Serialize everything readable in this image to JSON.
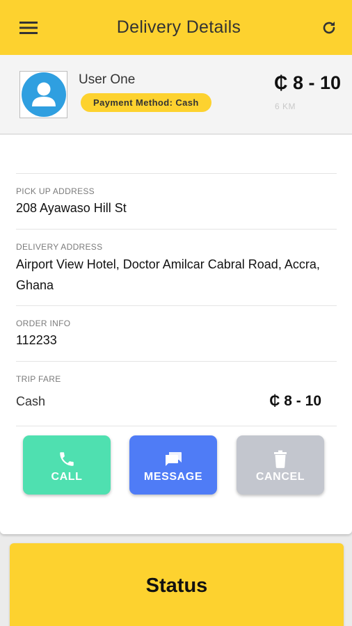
{
  "header": {
    "title": "Delivery Details",
    "menu_icon": "hamburger-menu-icon",
    "refresh_icon": "refresh-icon"
  },
  "user": {
    "name": "User One",
    "payment_badge": "Payment Method: Cash",
    "price": "₵ 8 - 10",
    "distance": "6 KM",
    "avatar_icon": "user-avatar-icon"
  },
  "details": {
    "pickup_label": "PICK UP ADDRESS",
    "pickup_value": "208 Ayawaso Hill St",
    "delivery_label": "DELIVERY ADDRESS",
    "delivery_value": "Airport View Hotel, Doctor Amilcar Cabral Road, Accra, Ghana",
    "order_label": "ORDER INFO",
    "order_value": "112233",
    "fare_label": "TRIP FARE",
    "fare_method": "Cash",
    "fare_amount": "₵ 8 - 10"
  },
  "actions": {
    "call": "CALL",
    "message": "MESSAGE",
    "cancel": "CANCEL"
  },
  "status": {
    "label": "Status"
  },
  "colors": {
    "brand_yellow": "#fdd22f",
    "call_green": "#4fe0b0",
    "message_blue": "#4f7cf6",
    "cancel_gray": "#c3c6ce",
    "avatar_blue": "#2f9fe0"
  }
}
